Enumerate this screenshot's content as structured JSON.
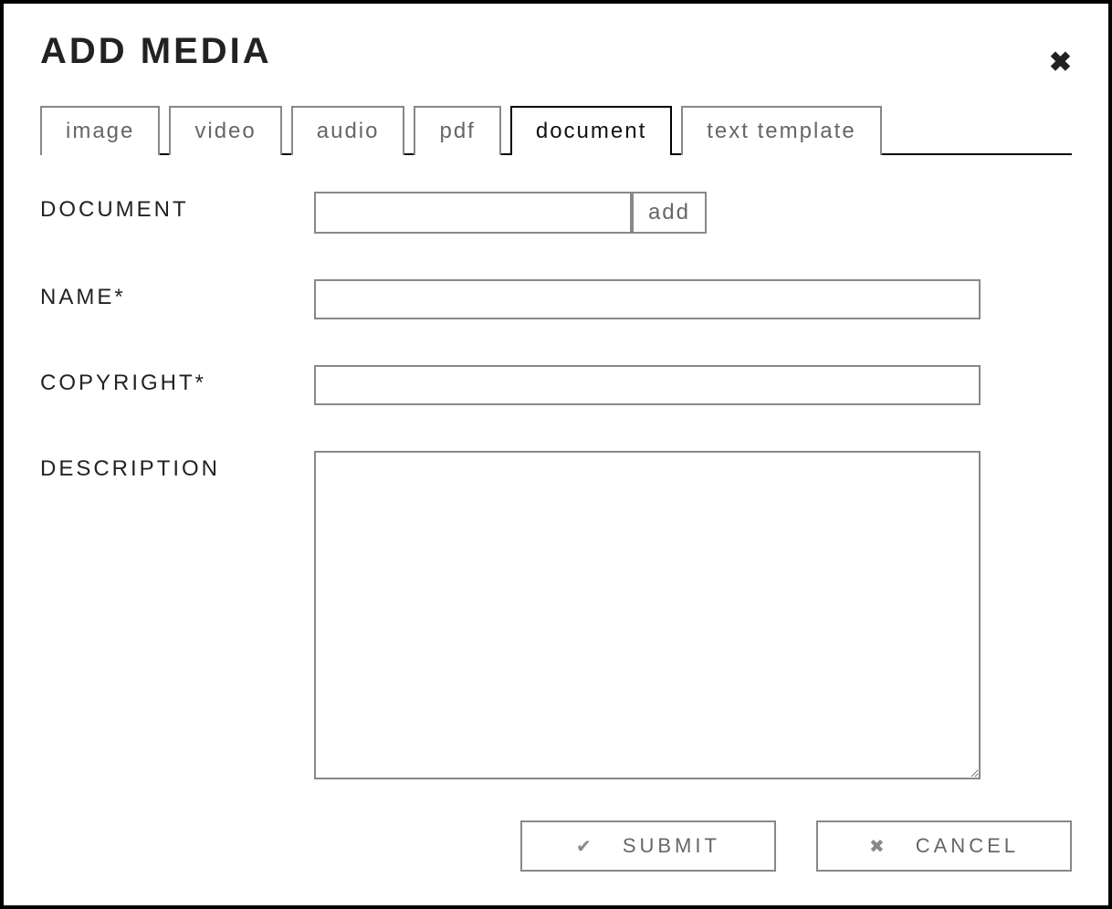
{
  "header": {
    "title": "ADD MEDIA",
    "close_glyph": "✖"
  },
  "tabs": [
    {
      "label": "image",
      "active": false
    },
    {
      "label": "video",
      "active": false
    },
    {
      "label": "audio",
      "active": false
    },
    {
      "label": "pdf",
      "active": false
    },
    {
      "label": "document",
      "active": true
    },
    {
      "label": "text template",
      "active": false
    }
  ],
  "form": {
    "document_label": "DOCUMENT",
    "document_value": "",
    "add_button_label": "add",
    "name_label": "NAME*",
    "name_value": "",
    "copyright_label": "COPYRIGHT*",
    "copyright_value": "",
    "description_label": "DESCRIPTION",
    "description_value": ""
  },
  "actions": {
    "submit_label": "SUBMIT",
    "submit_glyph": "✔",
    "cancel_label": "CANCEL",
    "cancel_glyph": "✖"
  }
}
